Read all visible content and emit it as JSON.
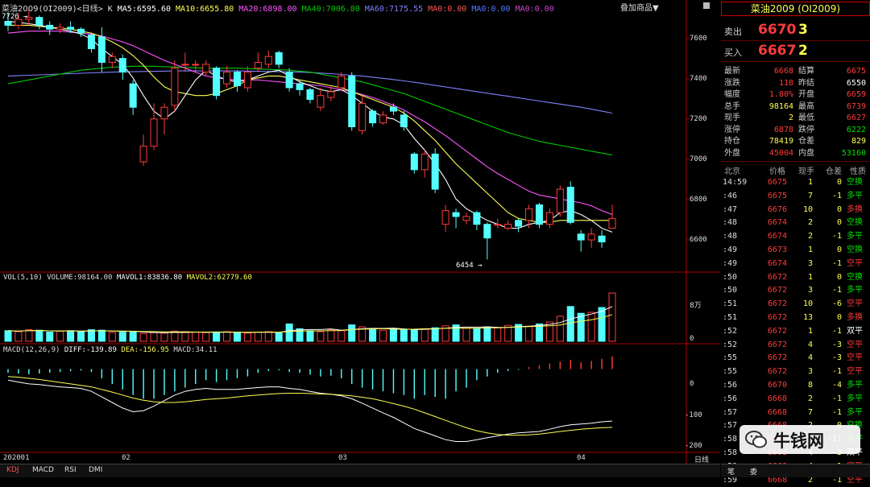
{
  "header": {
    "name": "菜油2009",
    "code_period": "(OI2009)<日线>",
    "k": "K",
    "ma5": "MA5:6595.60",
    "ma10": "MA10:6655.80",
    "ma20": "MA20:6898.00",
    "ma40": "MA40:7006.80",
    "ma60": "MA60:7175.55",
    "ma0a": "MA0:0.00",
    "ma0b": "MA0:0.00",
    "ma0c": "MA0:0.00",
    "overlay": "叠加商品",
    "overlay_arrow": "▼"
  },
  "colors": {
    "up": "#ff3b3b",
    "down": "#54ffff",
    "ma5": "#ffffff",
    "ma10": "#ffff54",
    "ma20": "#ff54ff",
    "ma40": "#00c800",
    "ma60": "#8080ff"
  },
  "price_axis": [
    "7600",
    "7400",
    "7200",
    "7000",
    "6800",
    "6600"
  ],
  "price_marks": {
    "high": "7726 →",
    "low": "6454 →"
  },
  "vol_header": {
    "label": "VOL(5,10)",
    "volume": "VOLUME:98164.00",
    "mavol1": "MAVOL1:83836.80",
    "mavol2": "MAVOL2:62779.60"
  },
  "vol_axis": [
    "8万",
    "0"
  ],
  "macd_header": {
    "label": "MACD(12,26,9)",
    "diff": "DIFF:-139.89",
    "dea": "DEA:-156.95",
    "macd": "MACD:34.11"
  },
  "macd_axis": [
    "0",
    "-100",
    "-200"
  ],
  "date_axis": [
    "202001",
    "02",
    "03",
    "04"
  ],
  "period_label": "日线",
  "bottom_tabs": [
    "KDJ",
    "MACD",
    "RSI",
    "DMI"
  ],
  "chart_data": {
    "type": "candlestick",
    "price_ylim": [
      6420,
      7740
    ],
    "candles": [
      [
        7680,
        7660,
        7726,
        7630
      ],
      [
        7660,
        7690,
        7720,
        7640
      ],
      [
        7690,
        7700,
        7740,
        7660
      ],
      [
        7700,
        7660,
        7710,
        7640
      ],
      [
        7660,
        7640,
        7680,
        7610
      ],
      [
        7640,
        7650,
        7670,
        7620
      ],
      [
        7650,
        7640,
        7680,
        7620
      ],
      [
        7640,
        7620,
        7650,
        7600
      ],
      [
        7610,
        7540,
        7620,
        7520
      ],
      [
        7600,
        7470,
        7650,
        7420
      ],
      [
        7470,
        7500,
        7520,
        7440
      ],
      [
        7490,
        7420,
        7510,
        7380
      ],
      [
        7360,
        7240,
        7380,
        7200
      ],
      [
        6960,
        7040,
        7100,
        6940
      ],
      [
        7040,
        7180,
        7260,
        7020
      ],
      [
        7180,
        7240,
        7260,
        7100
      ],
      [
        7250,
        7440,
        7480,
        7220
      ],
      [
        7460,
        7460,
        7520,
        7420
      ],
      [
        7460,
        7460,
        7480,
        7420
      ],
      [
        7420,
        7460,
        7480,
        7400
      ],
      [
        7440,
        7300,
        7450,
        7280
      ],
      [
        7360,
        7420,
        7450,
        7340
      ],
      [
        7420,
        7350,
        7430,
        7320
      ],
      [
        7340,
        7420,
        7450,
        7320
      ],
      [
        7440,
        7470,
        7520,
        7420
      ],
      [
        7460,
        7500,
        7530,
        7440
      ],
      [
        7520,
        7460,
        7530,
        7440
      ],
      [
        7420,
        7340,
        7440,
        7320
      ],
      [
        7360,
        7330,
        7380,
        7300
      ],
      [
        7330,
        7280,
        7340,
        7260
      ],
      [
        7240,
        7300,
        7340,
        7220
      ],
      [
        7290,
        7320,
        7350,
        7270
      ],
      [
        7340,
        7400,
        7420,
        7320
      ],
      [
        7400,
        7140,
        7420,
        7120
      ],
      [
        7120,
        7260,
        7300,
        7100
      ],
      [
        7220,
        7160,
        7230,
        7140
      ],
      [
        7160,
        7200,
        7220,
        7150
      ],
      [
        7240,
        7220,
        7260,
        7200
      ],
      [
        7200,
        7140,
        7220,
        7120
      ],
      [
        7000,
        6920,
        7010,
        6900
      ],
      [
        6920,
        7000,
        7020,
        6880
      ],
      [
        7000,
        6820,
        7030,
        6800
      ],
      [
        6640,
        6710,
        6740,
        6600
      ],
      [
        6700,
        6680,
        6720,
        6620
      ],
      [
        6660,
        6680,
        6700,
        6640
      ],
      [
        6700,
        6640,
        6710,
        6610
      ],
      [
        6640,
        6570,
        6650,
        6460
      ],
      [
        6640,
        6640,
        6670,
        6620
      ],
      [
        6620,
        6640,
        6660,
        6610
      ],
      [
        6660,
        6630,
        6670,
        6600
      ],
      [
        6660,
        6720,
        6740,
        6620
      ],
      [
        6740,
        6640,
        6750,
        6620
      ],
      [
        6640,
        6700,
        6720,
        6620
      ],
      [
        6700,
        6820,
        6840,
        6680
      ],
      [
        6830,
        6650,
        6860,
        6640
      ],
      [
        6590,
        6560,
        6610,
        6500
      ],
      [
        6560,
        6590,
        6620,
        6520
      ],
      [
        6580,
        6550,
        6610,
        6520
      ],
      [
        6620,
        6670,
        6740,
        6630
      ]
    ],
    "ma5": [
      7680,
      7675,
      7668,
      7660,
      7650,
      7640,
      7630,
      7615,
      7590,
      7540,
      7500,
      7460,
      7390,
      7300,
      7220,
      7180,
      7220,
      7300,
      7380,
      7430,
      7400,
      7380,
      7370,
      7380,
      7400,
      7420,
      7430,
      7400,
      7370,
      7350,
      7330,
      7320,
      7330,
      7300,
      7260,
      7220,
      7190,
      7180,
      7150,
      7080,
      7020,
      6950,
      6870,
      6770,
      6720,
      6690,
      6660,
      6640,
      6620,
      6620,
      6640,
      6650,
      6660,
      6700,
      6710,
      6690,
      6660,
      6620,
      6600
    ],
    "ma10": [
      7660,
      7660,
      7660,
      7655,
      7650,
      7645,
      7640,
      7630,
      7620,
      7600,
      7575,
      7545,
      7505,
      7455,
      7395,
      7345,
      7320,
      7310,
      7300,
      7300,
      7310,
      7330,
      7350,
      7380,
      7390,
      7400,
      7400,
      7390,
      7380,
      7370,
      7360,
      7350,
      7340,
      7320,
      7300,
      7280,
      7260,
      7240,
      7210,
      7170,
      7120,
      7070,
      7010,
      6950,
      6900,
      6850,
      6800,
      6750,
      6700,
      6670,
      6660,
      6650,
      6650,
      6660,
      6660,
      6660,
      6660,
      6660,
      6660
    ],
    "ma20": [
      7620,
      7625,
      7630,
      7630,
      7630,
      7630,
      7625,
      7620,
      7615,
      7605,
      7590,
      7575,
      7555,
      7530,
      7505,
      7480,
      7460,
      7440,
      7420,
      7400,
      7390,
      7385,
      7380,
      7380,
      7380,
      7375,
      7370,
      7365,
      7360,
      7355,
      7350,
      7340,
      7330,
      7320,
      7305,
      7290,
      7270,
      7250,
      7225,
      7195,
      7165,
      7130,
      7095,
      7055,
      7015,
      6975,
      6935,
      6900,
      6870,
      6840,
      6810,
      6790,
      6780,
      6770,
      6760,
      6750,
      6735,
      6710,
      6690
    ],
    "ma40": [
      7360,
      7370,
      7380,
      7390,
      7400,
      7410,
      7420,
      7430,
      7435,
      7440,
      7445,
      7448,
      7450,
      7450,
      7450,
      7448,
      7446,
      7444,
      7442,
      7440,
      7440,
      7440,
      7440,
      7438,
      7436,
      7434,
      7432,
      7430,
      7425,
      7420,
      7410,
      7400,
      7390,
      7380,
      7370,
      7355,
      7340,
      7325,
      7310,
      7290,
      7270,
      7250,
      7230,
      7210,
      7190,
      7170,
      7150,
      7130,
      7110,
      7095,
      7080,
      7065,
      7055,
      7045,
      7035,
      7025,
      7015,
      7005,
      6995
    ],
    "ma60": [
      7400,
      7402,
      7404,
      7406,
      7408,
      7410,
      7412,
      7414,
      7416,
      7418,
      7420,
      7421,
      7422,
      7423,
      7424,
      7425,
      7426,
      7426,
      7426,
      7426,
      7426,
      7426,
      7426,
      7425,
      7424,
      7423,
      7422,
      7421,
      7420,
      7418,
      7415,
      7412,
      7408,
      7404,
      7400,
      7394,
      7388,
      7382,
      7375,
      7368,
      7360,
      7352,
      7344,
      7336,
      7328,
      7320,
      7312,
      7304,
      7296,
      7288,
      7280,
      7272,
      7264,
      7256,
      7248,
      7240,
      7230,
      7220,
      7210
    ],
    "volume": [
      22,
      20,
      24,
      23,
      19,
      21,
      22,
      20,
      24,
      23,
      18,
      19,
      20,
      16,
      18,
      17,
      21,
      20,
      19,
      18,
      19,
      20,
      18,
      17,
      19,
      20,
      18,
      36,
      26,
      22,
      20,
      24,
      22,
      34,
      30,
      24,
      23,
      26,
      25,
      24,
      26,
      28,
      32,
      34,
      27,
      26,
      30,
      28,
      33,
      35,
      31,
      36,
      40,
      52,
      72,
      58,
      60,
      70,
      100
    ],
    "vol_ylim": [
      0,
      120
    ],
    "macd": [
      -10,
      -12,
      -14,
      -12,
      -10,
      -8,
      -6,
      -4,
      -8,
      -25,
      -40,
      -55,
      -70,
      -80,
      -80,
      -70,
      -60,
      -50,
      -40,
      -30,
      -35,
      -30,
      -25,
      -20,
      -10,
      -5,
      -3,
      -8,
      -10,
      -15,
      -20,
      -18,
      -25,
      -40,
      -50,
      -55,
      -60,
      -65,
      -70,
      -80,
      -70,
      -75,
      -80,
      -60,
      -50,
      -30,
      -20,
      -10,
      -5,
      -2,
      5,
      10,
      15,
      20,
      25,
      18,
      22,
      28,
      34
    ],
    "diff": [
      -30,
      -35,
      -40,
      -42,
      -45,
      -48,
      -50,
      -52,
      -60,
      -75,
      -90,
      -105,
      -115,
      -112,
      -100,
      -85,
      -70,
      -60,
      -55,
      -52,
      -55,
      -55,
      -55,
      -52,
      -50,
      -48,
      -48,
      -52,
      -55,
      -60,
      -65,
      -68,
      -72,
      -80,
      -92,
      -105,
      -118,
      -130,
      -145,
      -160,
      -170,
      -180,
      -190,
      -195,
      -195,
      -190,
      -185,
      -180,
      -175,
      -172,
      -170,
      -168,
      -162,
      -155,
      -150,
      -148,
      -146,
      -142,
      -140
    ],
    "dea": [
      -20,
      -22,
      -25,
      -28,
      -32,
      -36,
      -40,
      -44,
      -48,
      -55,
      -62,
      -70,
      -78,
      -84,
      -88,
      -90,
      -90,
      -88,
      -85,
      -82,
      -80,
      -78,
      -75,
      -72,
      -70,
      -68,
      -66,
      -65,
      -65,
      -66,
      -67,
      -68,
      -70,
      -72,
      -76,
      -80,
      -86,
      -93,
      -100,
      -108,
      -118,
      -128,
      -138,
      -148,
      -158,
      -166,
      -172,
      -176,
      -178,
      -178,
      -177,
      -175,
      -172,
      -168,
      -165,
      -162,
      -160,
      -158,
      -157
    ],
    "macd_ylim": [
      -220,
      40
    ]
  },
  "panel": {
    "title": "菜油2009 (OI2009)",
    "sell_label": "卖出",
    "sell_price": "6670",
    "sell_vol": "3",
    "buy_label": "买入",
    "buy_price": "6667",
    "buy_vol": "2",
    "stats": [
      {
        "l1": "最新",
        "v1": "6668",
        "c1": "#ff3b3b",
        "l2": "结算",
        "v2": "6675",
        "c2": "#ff3b3b"
      },
      {
        "l1": "涨跌",
        "v1": "118",
        "c1": "#ff3b3b",
        "l2": "昨结",
        "v2": "6550",
        "c2": "#ffffff"
      },
      {
        "l1": "幅度",
        "v1": "1.80%",
        "c1": "#ff3b3b",
        "l2": "开盘",
        "v2": "6659",
        "c2": "#ff3b3b"
      },
      {
        "l1": "总手",
        "v1": "98164",
        "c1": "#ffff54",
        "l2": "最高",
        "v2": "6739",
        "c2": "#ff3b3b"
      },
      {
        "l1": "现手",
        "v1": "2",
        "c1": "#ffff54",
        "l2": "最低",
        "v2": "6627",
        "c2": "#ff3b3b"
      },
      {
        "l1": "涨停",
        "v1": "6878",
        "c1": "#ff3b3b",
        "l2": "跌停",
        "v2": "6222",
        "c2": "#00e000"
      },
      {
        "l1": "持仓",
        "v1": "78419",
        "c1": "#ffff54",
        "l2": "仓差",
        "v2": "829",
        "c2": "#ffff54"
      },
      {
        "l1": "外盘",
        "v1": "45004",
        "c1": "#ff3b3b",
        "l2": "内盘",
        "v2": "53160",
        "c2": "#00e000"
      }
    ],
    "tick_headers": [
      "北京",
      "价格",
      "现手",
      "仓差",
      "性质"
    ],
    "ticks": [
      {
        "t": "14:59",
        "p": "6675",
        "v": "1",
        "d": "0",
        "n": "空换",
        "nc": "#00e000"
      },
      {
        "t": ":46",
        "p": "6675",
        "v": "7",
        "d": "-1",
        "n": "多平",
        "nc": "#00e000"
      },
      {
        "t": ":47",
        "p": "6676",
        "v": "10",
        "d": "0",
        "n": "多换",
        "nc": "#ff3b3b"
      },
      {
        "t": ":48",
        "p": "6674",
        "v": "2",
        "d": "0",
        "n": "空换",
        "nc": "#00e000"
      },
      {
        "t": ":48",
        "p": "6674",
        "v": "2",
        "d": "-1",
        "n": "多平",
        "nc": "#00e000"
      },
      {
        "t": ":49",
        "p": "6673",
        "v": "1",
        "d": "0",
        "n": "空换",
        "nc": "#00e000"
      },
      {
        "t": ":49",
        "p": "6674",
        "v": "3",
        "d": "-1",
        "n": "空平",
        "nc": "#ff3b3b"
      },
      {
        "t": ":50",
        "p": "6672",
        "v": "1",
        "d": "0",
        "n": "空换",
        "nc": "#00e000"
      },
      {
        "t": ":50",
        "p": "6672",
        "v": "3",
        "d": "-1",
        "n": "多平",
        "nc": "#00e000"
      },
      {
        "t": ":51",
        "p": "6672",
        "v": "10",
        "d": "-6",
        "n": "空平",
        "nc": "#ff3b3b"
      },
      {
        "t": ":51",
        "p": "6672",
        "v": "13",
        "d": "0",
        "n": "多换",
        "nc": "#ff3b3b"
      },
      {
        "t": ":52",
        "p": "6672",
        "v": "1",
        "d": "-1",
        "n": "双平",
        "nc": "#ffffff"
      },
      {
        "t": ":52",
        "p": "6672",
        "v": "4",
        "d": "-3",
        "n": "空平",
        "nc": "#ff3b3b"
      },
      {
        "t": ":55",
        "p": "6672",
        "v": "4",
        "d": "-3",
        "n": "空平",
        "nc": "#ff3b3b"
      },
      {
        "t": ":55",
        "p": "6672",
        "v": "3",
        "d": "-1",
        "n": "空平",
        "nc": "#ff3b3b"
      },
      {
        "t": ":56",
        "p": "6670",
        "v": "8",
        "d": "-4",
        "n": "多平",
        "nc": "#00e000"
      },
      {
        "t": ":56",
        "p": "6668",
        "v": "2",
        "d": "-1",
        "n": "多平",
        "nc": "#00e000"
      },
      {
        "t": ":57",
        "p": "6668",
        "v": "7",
        "d": "-1",
        "n": "多平",
        "nc": "#00e000"
      },
      {
        "t": ":57",
        "p": "6668",
        "v": "2",
        "d": "0",
        "n": "空换",
        "nc": "#00e000"
      },
      {
        "t": ":58",
        "p": "6668",
        "v": "17",
        "d": "-11",
        "n": "多平",
        "nc": "#00e000"
      },
      {
        "t": ":58",
        "p": "6668",
        "v": "4",
        "d": "-3",
        "n": "双平",
        "nc": "#ffffff"
      },
      {
        "t": ":59",
        "p": "6668",
        "v": "4",
        "d": "-1",
        "n": "空平",
        "nc": "#ff3b3b"
      },
      {
        "t": ":59",
        "p": "6668",
        "v": "2",
        "d": "-1",
        "n": "空平",
        "nc": "#ff3b3b"
      }
    ],
    "bottom_labels": [
      "笔",
      "委"
    ]
  },
  "watermark": {
    "text": "牛钱网"
  }
}
